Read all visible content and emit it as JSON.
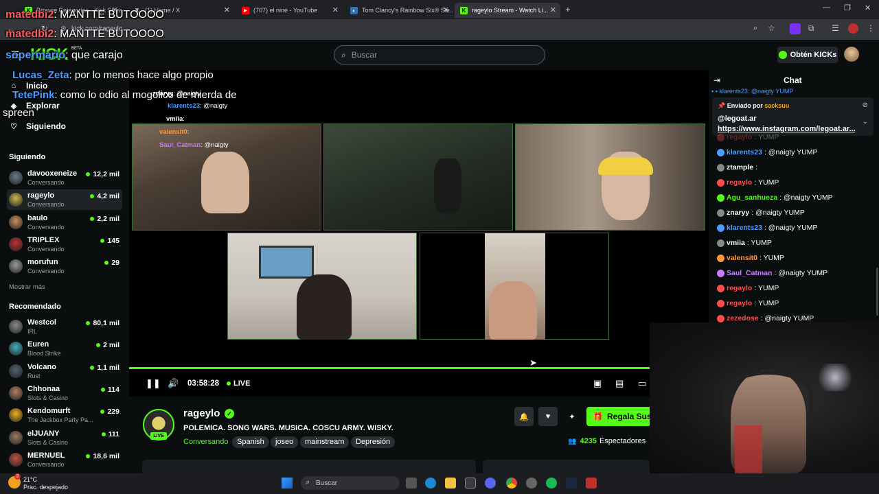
{
  "browser": {
    "tabs": [
      {
        "title": "Browse Categories - Kick Strea...",
        "color": "#53fc18",
        "active": false
      },
      {
        "title": "(1) Home / X",
        "color": "#ffffff",
        "active": false
      },
      {
        "title": "(707) el nine - YouTube",
        "color": "#ff0000",
        "active": false
      },
      {
        "title": "Tom Clancy's Rainbow Six® Sie...",
        "color": "#8ab4f8",
        "active": false
      },
      {
        "title": "rageylo Stream - Watch Li...",
        "color": "#53fc18",
        "active": true
      }
    ],
    "new_tab": "+",
    "url": "kick.com/rageylo"
  },
  "header": {
    "logo": "KICK",
    "logo_beta": "BETA",
    "search_placeholder": "Buscar",
    "kicks_button": "Obtén KICKs"
  },
  "nav": {
    "items": [
      {
        "label": "Inicio",
        "icon": "home-icon"
      },
      {
        "label": "Explorar",
        "icon": "compass-icon"
      },
      {
        "label": "Siguiendo",
        "icon": "heart-icon"
      }
    ]
  },
  "following": {
    "title": "Siguiendo",
    "channels": [
      {
        "name": "davooxeneize",
        "category": "Conversando",
        "viewers": "12,2 mil",
        "color": "#6a7a8a"
      },
      {
        "name": "rageylo",
        "category": "Conversando",
        "viewers": "4,2 mil",
        "color": "#c8b84a"
      },
      {
        "name": "baulo",
        "category": "Conversando",
        "viewers": "2,2 mil",
        "color": "#c89060"
      },
      {
        "name": "TRIPLEX",
        "category": "Conversando",
        "viewers": "145",
        "color": "#c03030"
      },
      {
        "name": "morufun",
        "category": "Conversando",
        "viewers": "29",
        "color": "#9a9a9a"
      }
    ],
    "show_more": "Mostrar más"
  },
  "recommended": {
    "title": "Recomendado",
    "channels": [
      {
        "name": "Westcol",
        "category": "IRL",
        "viewers": "80,1 mil",
        "color": "#8a8a8a"
      },
      {
        "name": "Euren",
        "category": "Blood Strike",
        "viewers": "2 mil",
        "color": "#40b0c0"
      },
      {
        "name": "Volcano",
        "category": "Rust",
        "viewers": "1,1 mil",
        "color": "#506070"
      },
      {
        "name": "Chhonaa",
        "category": "Slots & Casino",
        "viewers": "114",
        "color": "#b08060"
      },
      {
        "name": "Kendomurft",
        "category": "The Jackbox Party Pa...",
        "viewers": "229",
        "color": "#f0b020"
      },
      {
        "name": "elJUANY",
        "category": "Slots & Casino",
        "viewers": "111",
        "color": "#9a7a5a"
      },
      {
        "name": "MERNUEL",
        "category": "Conversando",
        "viewers": "18,6 mil",
        "color": "#c05040"
      }
    ]
  },
  "overlay_chat": [
    {
      "user": "matedbi2",
      "text": ": MANTTE BUTOOOO"
    },
    {
      "user": "matedbi2",
      "text": ": MANTTE BUTOOOO"
    },
    {
      "user": "sopermario",
      "text": ": que carajo"
    },
    {
      "user": "Lucas_Zeta",
      "text": ": por lo menos hace algo propio"
    },
    {
      "user": "TetePink",
      "text": ": como lo odio al mogolico de mierda de"
    },
    {
      "user": "",
      "text": "spreen"
    }
  ],
  "stream_overlay_chat": [
    {
      "user": "znaryy",
      "text": ": @naigty"
    },
    {
      "user": "klarents23",
      "text": ": @naigty"
    },
    {
      "user": "vmiia",
      "text": ":"
    },
    {
      "user": "valensit0",
      "text": ":"
    },
    {
      "user": "Saul_Catman",
      "text": ": @naigty"
    }
  ],
  "player": {
    "time": "03:58:28",
    "live": "LIVE",
    "progress": 1.0
  },
  "channel": {
    "name": "rageylo",
    "live_badge": "LIVE",
    "title": "POLEMICA. SONG WARS. MUSICA. COSCU ARMY. WISKY.",
    "category": "Conversando",
    "tags": [
      "Spanish",
      "joseo",
      "mainstream",
      "Depresión"
    ],
    "gift_button": "Regala Susc",
    "viewers_count": "4235",
    "viewers_label": "Espectadores"
  },
  "chat": {
    "title": "Chat",
    "pinned": {
      "by_label": "Enviado por",
      "by_user": "sacksuu",
      "message": "@legoat.ar",
      "link": "https://www.instagram.com/legoat.ar..."
    },
    "messages": [
      {
        "user": "regaylo",
        "text": ": YUMP",
        "color": "#ff4d4d"
      },
      {
        "user": "klarents23",
        "text": ": @naigty YUMP",
        "color": "#4d9cff"
      },
      {
        "user": "ztample",
        "text": ":",
        "color": "#ffffff"
      },
      {
        "user": "regaylo",
        "text": ": YUMP",
        "color": "#ff4d4d"
      },
      {
        "user": "Agu_sanhueza",
        "text": ": @naigty YUMP",
        "color": "#53fc18"
      },
      {
        "user": "znaryy",
        "text": ": @naigty YUMP",
        "color": "#ffffff"
      },
      {
        "user": "klarents23",
        "text": ": @naigty YUMP",
        "color": "#4d9cff"
      },
      {
        "user": "vmiia",
        "text": ": YUMP",
        "color": "#ffffff"
      },
      {
        "user": "valensit0",
        "text": ": YUMP",
        "color": "#ff9a3c"
      },
      {
        "user": "Saul_Catman",
        "text": ": @naigty YUMP",
        "color": "#c77dff"
      },
      {
        "user": "regaylo",
        "text": ": YUMP",
        "color": "#ff4d4d"
      },
      {
        "user": "regaylo",
        "text": ": YUMP",
        "color": "#ff4d4d"
      },
      {
        "user": "zezedose",
        "text": ": @naigty YUMP",
        "color": "#ff4d4d"
      }
    ]
  },
  "taskbar": {
    "temperature": "21°C",
    "weather": "Prac. despejado",
    "weather_badge": "2",
    "search_placeholder": "Buscar"
  }
}
